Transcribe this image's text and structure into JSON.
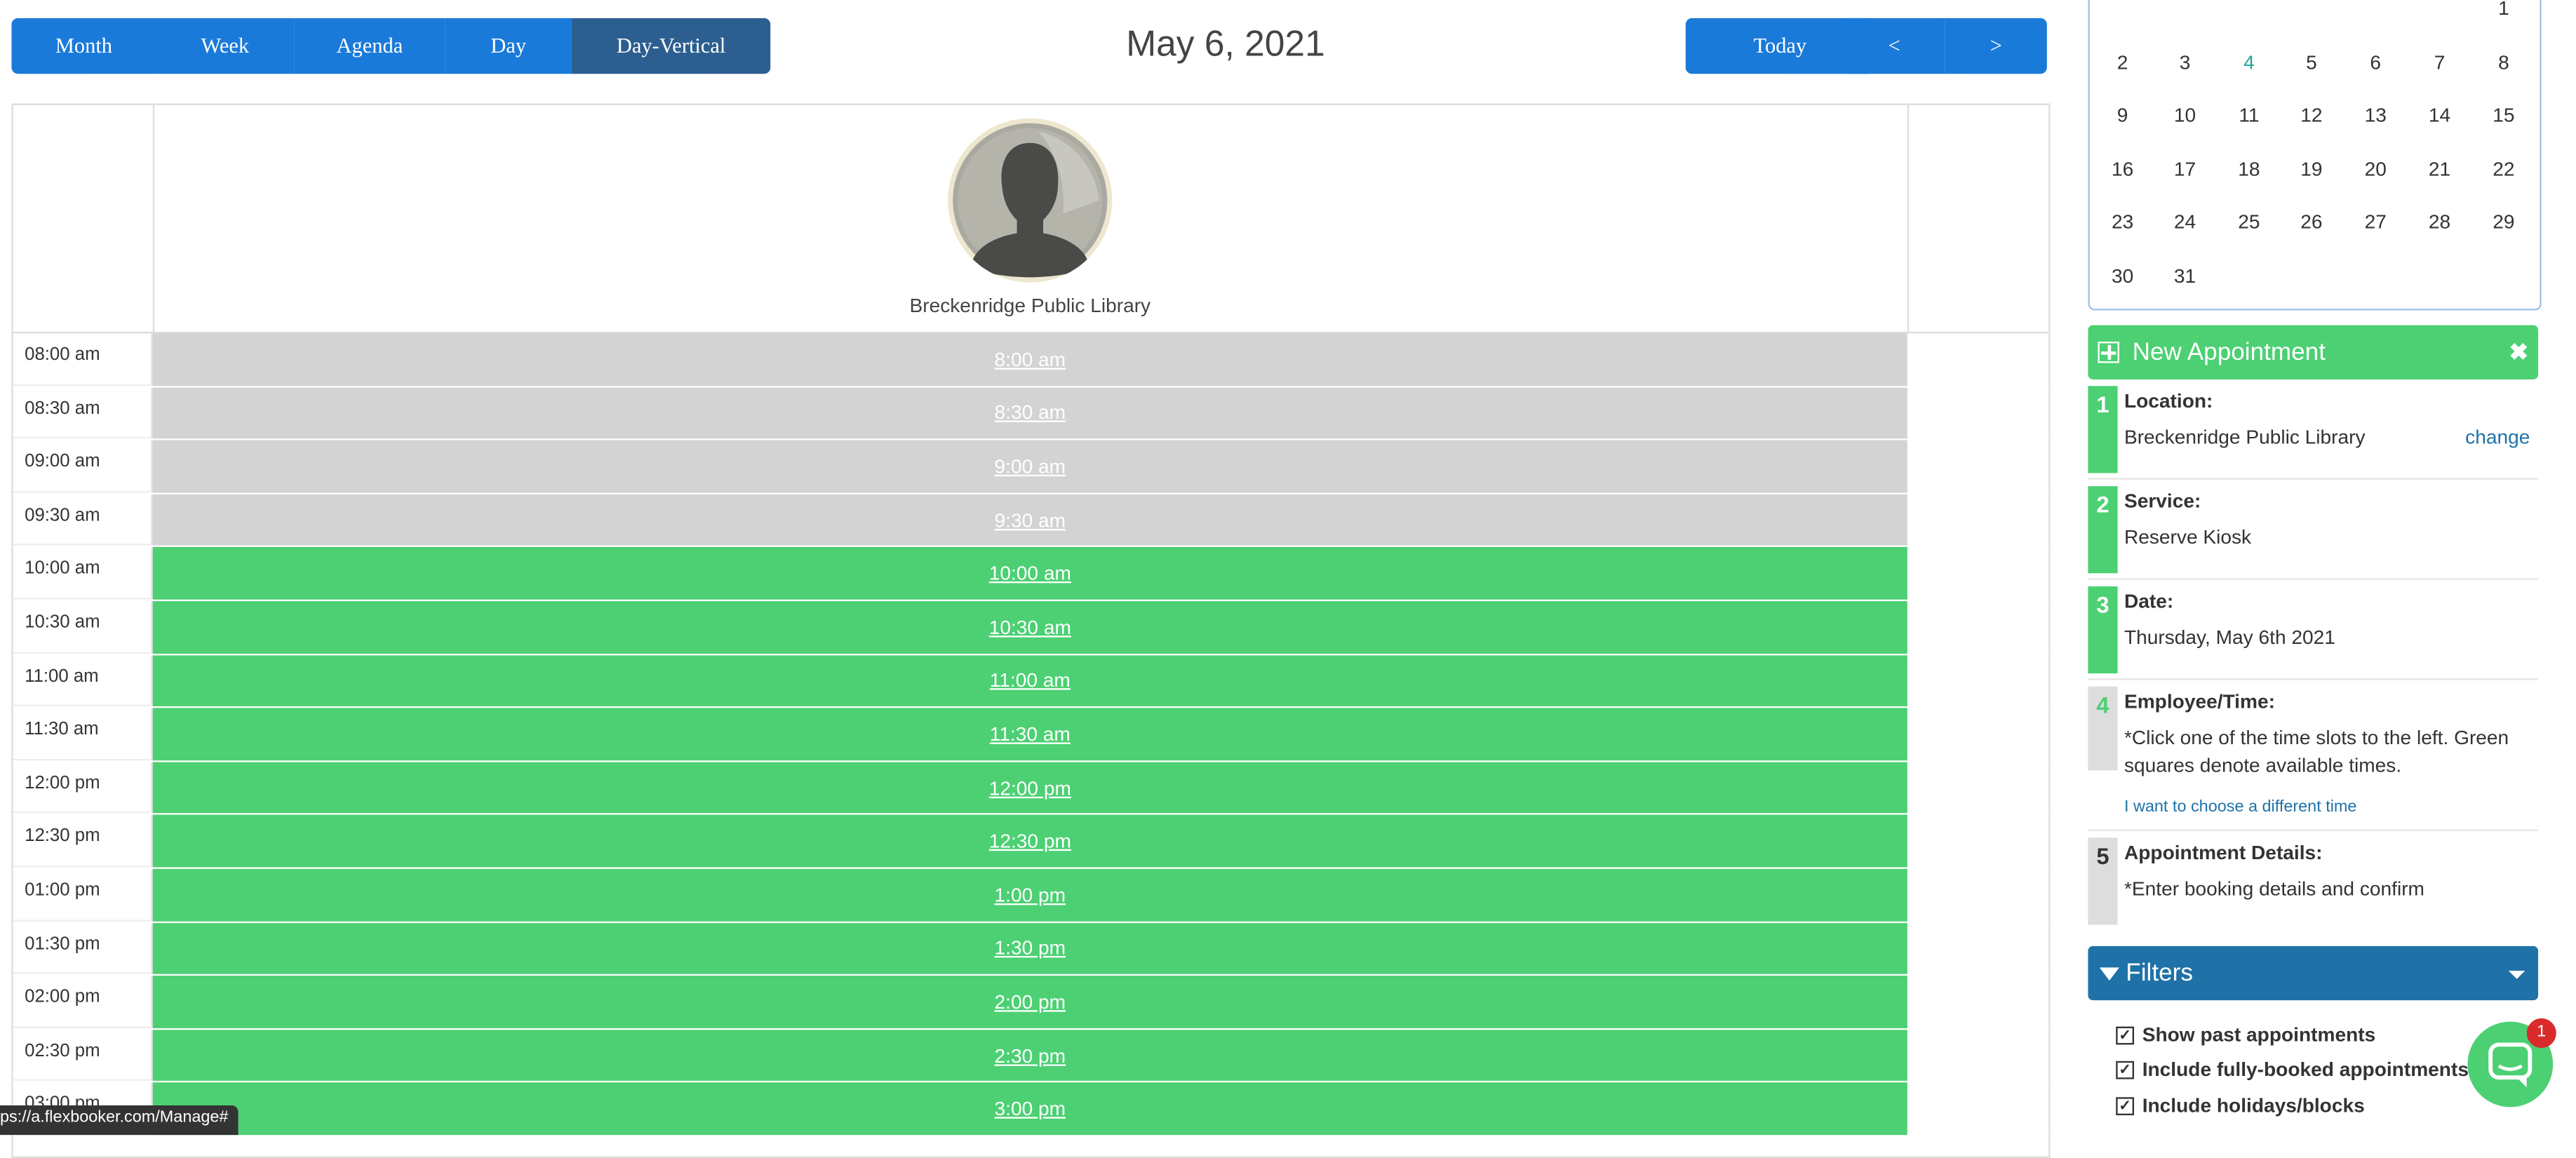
{
  "toolbar": {
    "views": [
      "Month",
      "Week",
      "Agenda",
      "Day",
      "Day-Vertical"
    ],
    "active_view": "Day-Vertical",
    "title": "May 6, 2021",
    "today": "Today",
    "prev": "<",
    "next": ">"
  },
  "calendar": {
    "resource_name": "Breckenridge Public Library",
    "rows": [
      {
        "time": "08:00 am",
        "slot": "8:00 am",
        "available": false
      },
      {
        "time": "08:30 am",
        "slot": "8:30 am",
        "available": false
      },
      {
        "time": "09:00 am",
        "slot": "9:00 am",
        "available": false
      },
      {
        "time": "09:30 am",
        "slot": "9:30 am",
        "available": false
      },
      {
        "time": "10:00 am",
        "slot": "10:00 am",
        "available": true
      },
      {
        "time": "10:30 am",
        "slot": "10:30 am",
        "available": true
      },
      {
        "time": "11:00 am",
        "slot": "11:00 am",
        "available": true
      },
      {
        "time": "11:30 am",
        "slot": "11:30 am",
        "available": true
      },
      {
        "time": "12:00 pm",
        "slot": "12:00 pm",
        "available": true
      },
      {
        "time": "12:30 pm",
        "slot": "12:30 pm",
        "available": true
      },
      {
        "time": "01:00 pm",
        "slot": "1:00 pm",
        "available": true
      },
      {
        "time": "01:30 pm",
        "slot": "1:30 pm",
        "available": true
      },
      {
        "time": "02:00 pm",
        "slot": "2:00 pm",
        "available": true
      },
      {
        "time": "02:30 pm",
        "slot": "2:30 pm",
        "available": true
      },
      {
        "time": "03:00 pm",
        "slot": "3:00 pm",
        "available": true
      }
    ]
  },
  "mini_calendar": {
    "weeks": [
      [
        "",
        "",
        "",
        "",
        "",
        "",
        "1"
      ],
      [
        "2",
        "3",
        "4",
        "5",
        "6",
        "7",
        "8"
      ],
      [
        "9",
        "10",
        "11",
        "12",
        "13",
        "14",
        "15"
      ],
      [
        "16",
        "17",
        "18",
        "19",
        "20",
        "21",
        "22"
      ],
      [
        "23",
        "24",
        "25",
        "26",
        "27",
        "28",
        "29"
      ],
      [
        "30",
        "31",
        "",
        "",
        "",
        "",
        ""
      ]
    ],
    "highlight": "4"
  },
  "new_appointment": {
    "title": "New Appointment",
    "close_icon": "close-icon",
    "steps": [
      {
        "num": "1",
        "label": "Location:",
        "value": "Breckenridge Public Library",
        "action": "change"
      },
      {
        "num": "2",
        "label": "Service:",
        "value": "Reserve Kiosk"
      },
      {
        "num": "3",
        "label": "Date:",
        "value": "Thursday, May 6th 2021"
      },
      {
        "num": "4",
        "label": "Employee/Time:",
        "value": "*Click one of the time slots to the left. Green squares denote available times.",
        "link": "I want to choose a different time"
      },
      {
        "num": "5",
        "label": "Appointment Details:",
        "value": "*Enter booking details and confirm"
      }
    ]
  },
  "filters": {
    "title": "Filters",
    "items": [
      "Show past appointments",
      "Include fully-booked appointments",
      "Include holidays/blocks"
    ]
  },
  "chat": {
    "badge": "1"
  },
  "status_bar": "ps://a.flexbooker.com/Manage#",
  "colors": {
    "primary": "#1a7ad9",
    "active": "#2c5f90",
    "available": "#4cd073",
    "unavailable": "#d3d3d3",
    "filters": "#1f72a8"
  }
}
